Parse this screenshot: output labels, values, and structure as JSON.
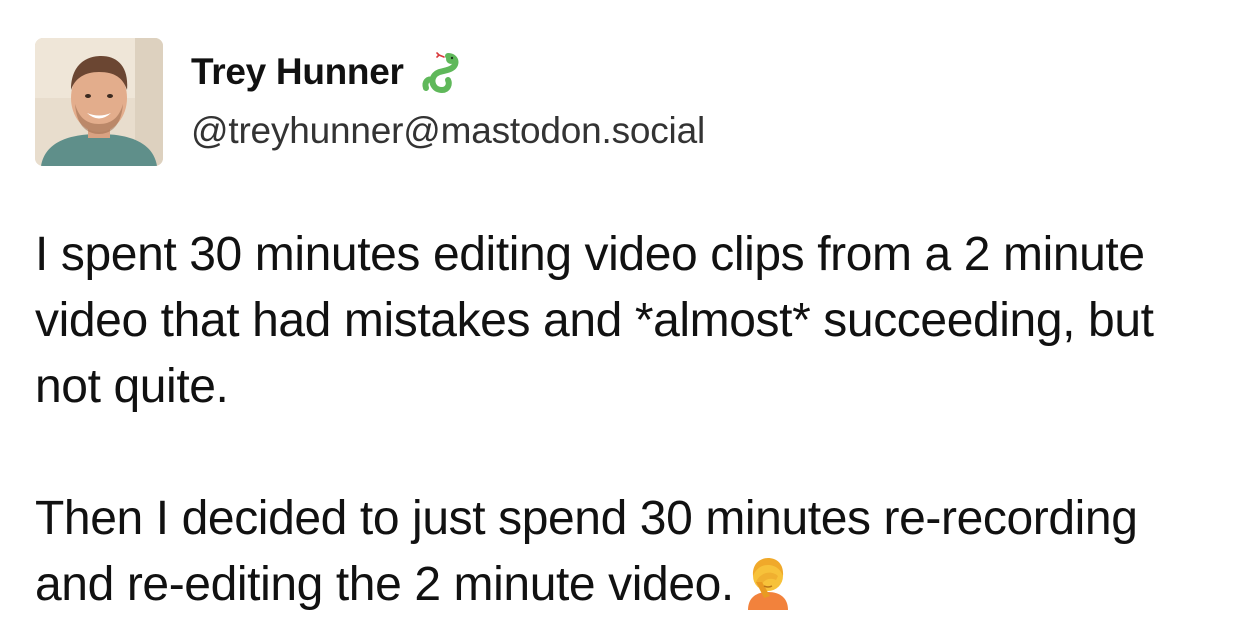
{
  "author": {
    "display_name": "Trey Hunner",
    "handle": "@treyhunner@mastodon.social",
    "avatar_icon": "profile-photo",
    "name_emoji_icon": "snake-icon"
  },
  "post": {
    "paragraph_1": "I spent 30 minutes editing video clips from a 2 minute video that had mistakes and *almost* succeeding, but not quite.",
    "paragraph_2": "Then I decided to just spend 30 minutes re-recording and re-editing the 2 minute video.",
    "trailing_emoji_icon": "facepalm-icon"
  },
  "colors": {
    "text": "#111111",
    "handle": "#333333",
    "snake": "#5fb85a",
    "facepalm_skin": "#f7c23a",
    "facepalm_shirt": "#f2823c"
  }
}
